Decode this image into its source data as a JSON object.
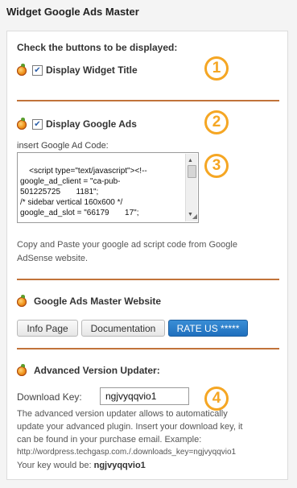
{
  "title": "Widget Google Ads Master",
  "section1": {
    "heading": "Check the buttons to be displayed:",
    "checkbox_label": "Display Widget Title",
    "checked": true,
    "badge": "1"
  },
  "section2": {
    "checkbox_label": "Display Google Ads",
    "checked": true,
    "badge": "2",
    "code_label": "insert Google Ad Code:",
    "code_value": "<script type=\"text/javascript\"><!--\ngoogle_ad_client = \"ca-pub-\n501225725       1181\";\n/* sidebar vertical 160x600 */\ngoogle_ad_slot = \"66179       17\";",
    "code_badge": "3",
    "help_line1": "Copy and Paste your google ad script code from Google",
    "help_line2": "AdSense website."
  },
  "section3": {
    "heading": "Google Ads Master Website",
    "buttons": {
      "info": "Info Page",
      "docs": "Documentation",
      "rate": "RATE US *****"
    }
  },
  "section4": {
    "heading": "Advanced Version Updater:",
    "key_label": "Download Key:",
    "key_value": "ngjvyqqvio1",
    "badge": "4",
    "desc_line1": "The advanced version updater allows to automatically",
    "desc_line2": "update your advanced plugin. Insert your download key, it",
    "desc_line3": "can be found in your purchase email. Example:",
    "desc_line4": "http://wordpress.techgasp.com./.downloads_key=ngjvyqqvio1",
    "key_would_be": "Your key would be:",
    "key_example": "ngjvyqqvio1"
  },
  "colors": {
    "accent_orange": "#f5a623",
    "separator": "#c1733a",
    "rate_button": "#1f6fbd"
  },
  "icons": [
    "orange-fruit-icon",
    "checkbox-checked-icon"
  ]
}
